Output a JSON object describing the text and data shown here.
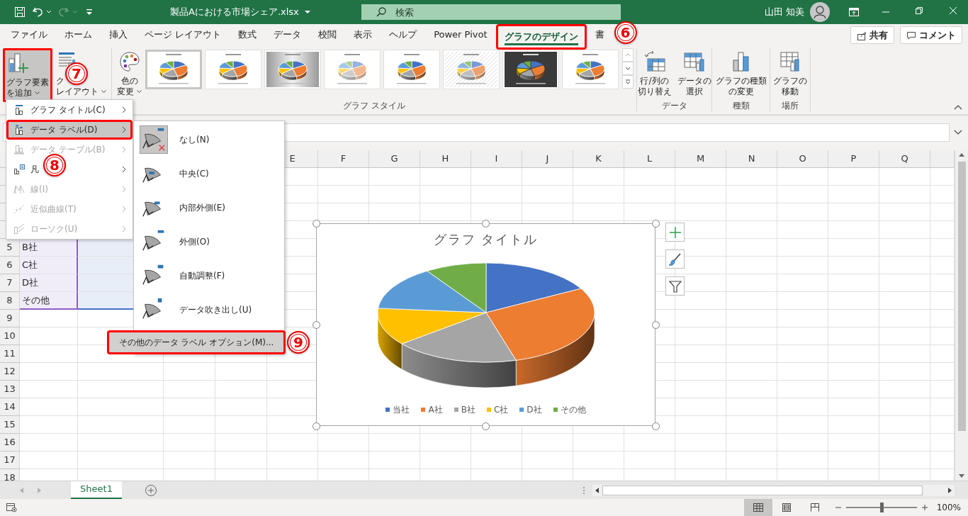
{
  "window": {
    "filename": "製品Aにおける市場シェア.xlsx",
    "search": {
      "placeholder": "検索"
    },
    "user": "山田 知美"
  },
  "tabs": [
    {
      "label": "ファイル",
      "selected": false
    },
    {
      "label": "ホーム",
      "selected": false
    },
    {
      "label": "挿入",
      "selected": false
    },
    {
      "label": "ページ レイアウト",
      "selected": false
    },
    {
      "label": "数式",
      "selected": false
    },
    {
      "label": "データ",
      "selected": false
    },
    {
      "label": "校閲",
      "selected": false
    },
    {
      "label": "表示",
      "selected": false
    },
    {
      "label": "ヘルプ",
      "selected": false
    },
    {
      "label": "Power Pivot",
      "selected": false
    },
    {
      "label": "グラフのデザイン",
      "selected": true,
      "step": "6"
    },
    {
      "label": "書",
      "selected": false
    }
  ],
  "header_buttons": [
    {
      "kind": "share",
      "label": "共有"
    },
    {
      "kind": "comment",
      "label": "コメント"
    }
  ],
  "ribbon": {
    "element_buttons": [
      {
        "kind": "add-element",
        "lines": [
          "グラフ要素",
          "を追加"
        ],
        "expanded": true,
        "step": "7"
      },
      {
        "kind": "quick-layout",
        "lines": [
          "ク",
          "レイアウト"
        ],
        "expanded": false
      }
    ],
    "style_group": {
      "label": "グラフ スタイル",
      "color_button": {
        "kind": "colors",
        "lines": [
          "色の",
          "変更"
        ]
      },
      "styles": [
        {
          "kind": "plain",
          "selected": true
        },
        {
          "kind": "labeled",
          "selected": false
        },
        {
          "kind": "gray",
          "selected": false
        },
        {
          "kind": "faded",
          "selected": false
        },
        {
          "kind": "plain",
          "selected": false
        },
        {
          "kind": "hatched",
          "selected": false
        },
        {
          "kind": "dark",
          "selected": false
        },
        {
          "kind": "labeled",
          "selected": false
        }
      ]
    },
    "groups": [
      {
        "label": "データ",
        "buttons": [
          {
            "kind": "switch-row-column",
            "lines": [
              "行/列の",
              "切り替え"
            ]
          },
          {
            "kind": "select-data",
            "lines": [
              "データの",
              "選択"
            ]
          }
        ]
      },
      {
        "label": "種類",
        "buttons": [
          {
            "kind": "change-type",
            "lines": [
              "グラフの種類",
              "の変更"
            ]
          }
        ]
      },
      {
        "label": "場所",
        "buttons": [
          {
            "kind": "move-chart",
            "lines": [
              "グラフの",
              "移動"
            ]
          }
        ]
      }
    ]
  },
  "add_element_menu": {
    "items": [
      {
        "kind": "title",
        "label": "グラフ タイトル(C)",
        "selected": false,
        "disabled": false
      },
      {
        "kind": "data-labels",
        "label": "データ ラベル(D)",
        "selected": true,
        "disabled": false,
        "step": "8"
      },
      {
        "kind": "data-table",
        "label": "データ テーブル(B)",
        "selected": false,
        "disabled": true
      },
      {
        "kind": "legend",
        "label": "凡",
        "selected": false,
        "disabled": false
      },
      {
        "kind": "lines",
        "label": "線(I)",
        "selected": false,
        "disabled": true
      },
      {
        "kind": "trendline",
        "label": "近似曲線(T)",
        "selected": false,
        "disabled": true
      },
      {
        "kind": "updown",
        "label": "ローソク(U)",
        "selected": false,
        "disabled": true
      }
    ]
  },
  "data_label_submenu": {
    "items": [
      {
        "kind": "none",
        "label": "なし(N)",
        "selected": true
      },
      {
        "kind": "center",
        "label": "中央(C)",
        "selected": false
      },
      {
        "kind": "inside-end",
        "label": "内部外側(E)",
        "selected": false
      },
      {
        "kind": "outside-end",
        "label": "外側(O)",
        "selected": false
      },
      {
        "kind": "best-fit",
        "label": "自動調整(F)",
        "selected": false
      },
      {
        "kind": "callout",
        "label": "データ吹き出し(U)",
        "selected": false
      }
    ],
    "more_button": {
      "label": "その他のデータ ラベル オプション(M)...",
      "step": "9"
    }
  },
  "sheet": {
    "columns": [
      "E",
      "F",
      "G",
      "H",
      "I",
      "J",
      "K",
      "L",
      "M",
      "N",
      "O",
      "P",
      "Q"
    ],
    "rows": [
      {
        "number": "5",
        "cells": [
          "B社"
        ],
        "in_chart_range": true
      },
      {
        "number": "6",
        "cells": [
          "C社"
        ],
        "in_chart_range": true
      },
      {
        "number": "7",
        "cells": [
          "D社"
        ],
        "in_chart_range": true
      },
      {
        "number": "8",
        "cells": [
          "その他"
        ],
        "in_chart_range": true
      },
      {
        "number": "9",
        "in_chart_range": false
      },
      {
        "number": "10",
        "in_chart_range": false
      },
      {
        "number": "11",
        "in_chart_range": false
      },
      {
        "number": "12",
        "in_chart_range": false
      },
      {
        "number": "13",
        "in_chart_range": false
      },
      {
        "number": "14",
        "in_chart_range": false
      },
      {
        "number": "15",
        "in_chart_range": false
      },
      {
        "number": "16",
        "in_chart_range": false
      },
      {
        "number": "17",
        "in_chart_range": false
      },
      {
        "number": "18",
        "in_chart_range": false
      }
    ]
  },
  "chart": {
    "title": "グラフ タイトル",
    "legend": [
      {
        "label": "当社",
        "color": "#4472c4"
      },
      {
        "label": "A社",
        "color": "#ed7d31"
      },
      {
        "label": "B社",
        "color": "#a5a5a5"
      },
      {
        "label": "C社",
        "color": "#ffc000"
      },
      {
        "label": "D社",
        "color": "#5b9bd5"
      },
      {
        "label": "その他",
        "color": "#70ad47"
      }
    ]
  },
  "sheet_tabs": [
    {
      "label": "Sheet1",
      "selected": true
    }
  ],
  "status_bar": {
    "views": [
      {
        "kind": "normal",
        "selected": true
      },
      {
        "kind": "page-layout",
        "selected": false
      },
      {
        "kind": "page-break",
        "selected": false
      }
    ],
    "zoom": {
      "level": 0.5,
      "reading": "100%"
    }
  }
}
